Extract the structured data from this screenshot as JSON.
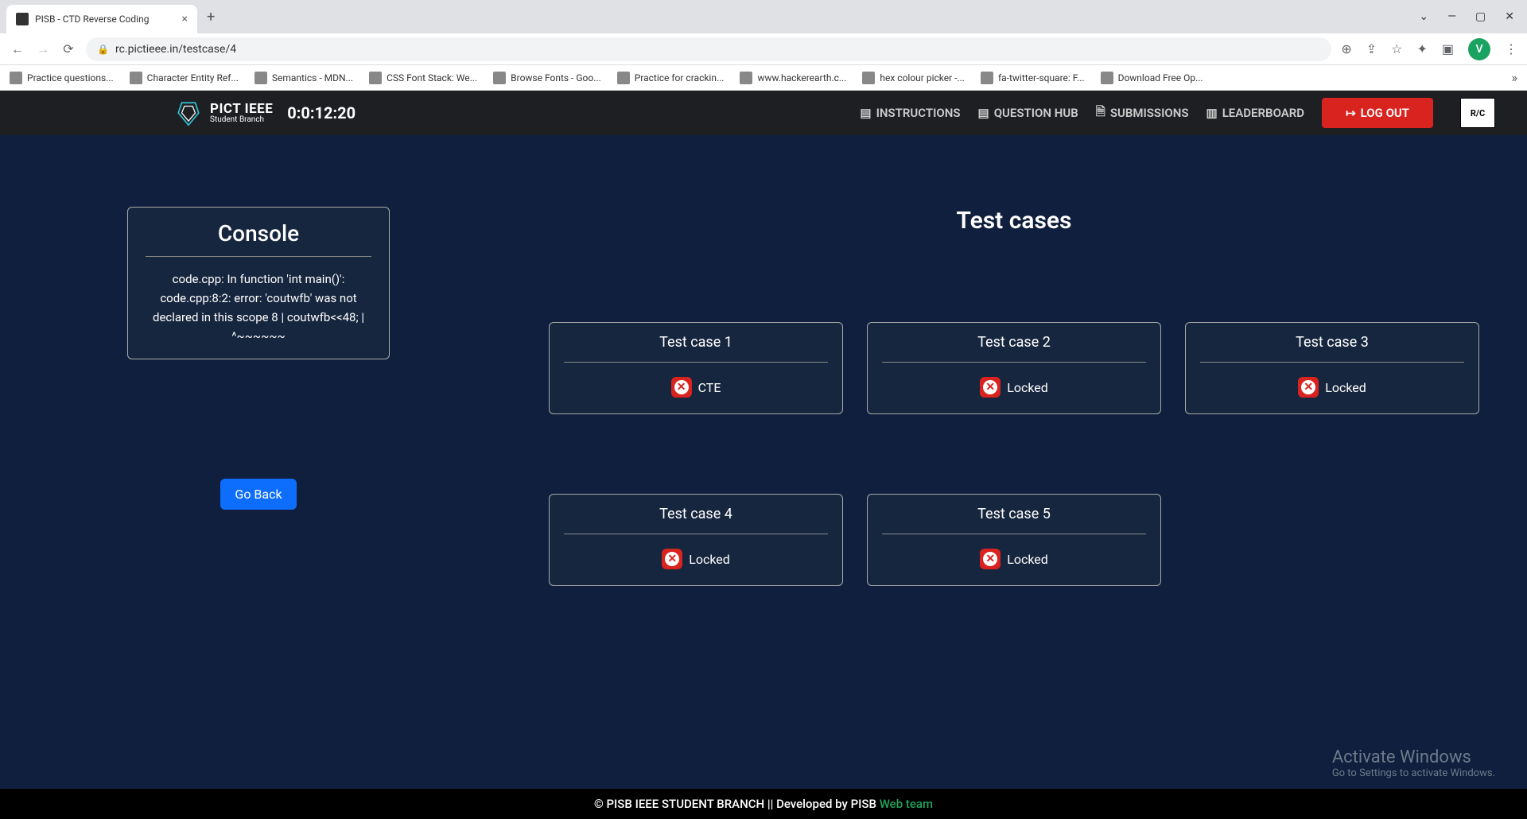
{
  "browser": {
    "tab_title": "PISB - CTD Reverse Coding",
    "url": "rc.pictieee.in/testcase/4",
    "avatar_letter": "V",
    "bookmarks": [
      "Practice questions...",
      "Character Entity Ref...",
      "Semantics - MDN...",
      "CSS Font Stack: We...",
      "Browse Fonts - Goo...",
      "Practice for crackin...",
      "www.hackerearth.c...",
      "hex colour picker -...",
      "fa-twitter-square: F...",
      "Download Free Op..."
    ]
  },
  "header": {
    "brand_main": "PICT IEEE",
    "brand_sub": "Student Branch",
    "timer": "0:0:12:20",
    "nav": {
      "instructions": "INSTRUCTIONS",
      "question_hub": "QUESTION HUB",
      "submissions": "SUBMISSIONS",
      "leaderboard": "LEADERBOARD"
    },
    "logout": "LOG OUT",
    "rc_logo": "R/C"
  },
  "console": {
    "title": "Console",
    "body": "code.cpp: In function 'int main()': code.cpp:8:2: error: 'coutwfb' was not declared in this scope 8 | coutwfb<<48; | ^~~~~~~"
  },
  "go_back_label": "Go Back",
  "testcases": {
    "title": "Test cases",
    "items": [
      {
        "name": "Test case 1",
        "status": "CTE"
      },
      {
        "name": "Test case 2",
        "status": "Locked"
      },
      {
        "name": "Test case 3",
        "status": "Locked"
      },
      {
        "name": "Test case 4",
        "status": "Locked"
      },
      {
        "name": "Test case 5",
        "status": "Locked"
      }
    ]
  },
  "footer": {
    "text": "© PISB IEEE STUDENT BRANCH || Developed by PISB ",
    "link": "Web team"
  },
  "watermark": {
    "title": "Activate Windows",
    "sub": "Go to Settings to activate Windows."
  }
}
